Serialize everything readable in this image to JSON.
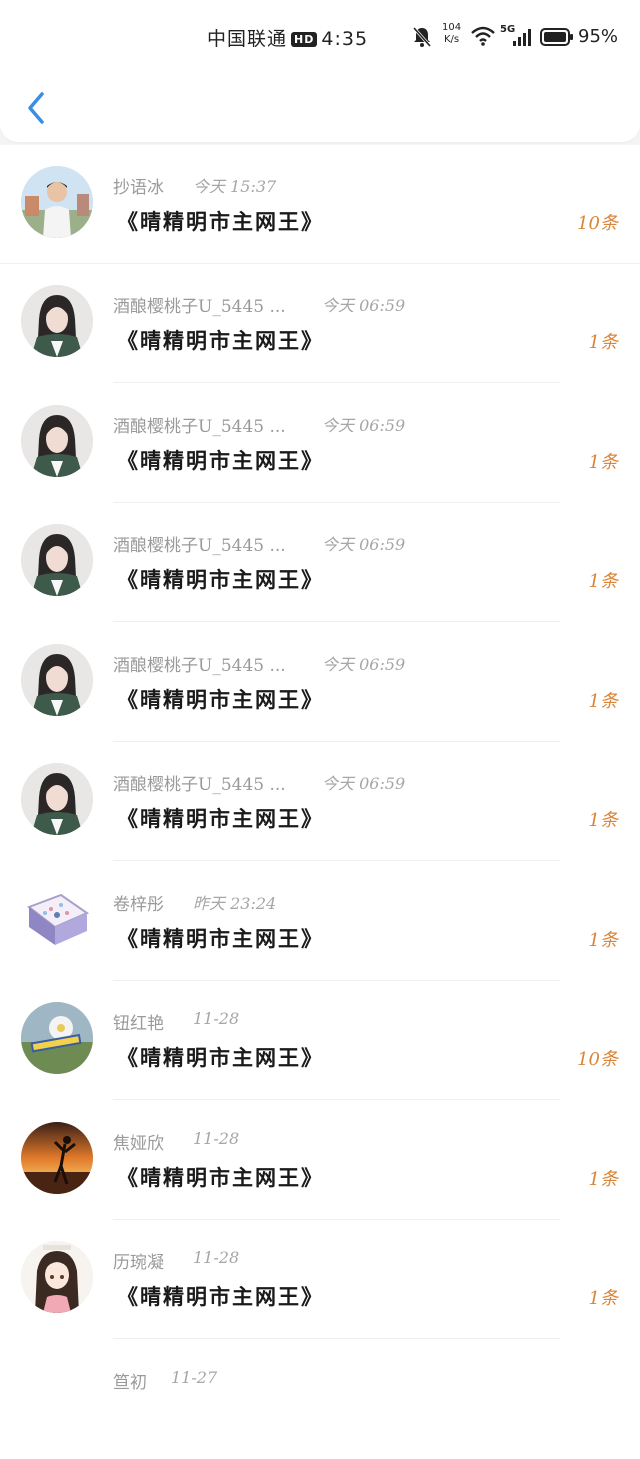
{
  "status_bar": {
    "carrier": "中国联通",
    "hd": "HD",
    "time": "4:35",
    "speed_top": "104",
    "speed_bottom": "K/s",
    "network": "5G",
    "battery": "95%"
  },
  "colors": {
    "accent_back": "#3a8ee6",
    "count": "#d9853a"
  },
  "rows": [
    {
      "name": "抄语冰",
      "date": "今天 15:37",
      "title": "《晴精明市主网王》",
      "count": "10条",
      "avatar": "boy-photo"
    },
    {
      "name": "酒酿樱桃子U_5445 ...",
      "date": "今天 06:59",
      "title": "《晴精明市主网王》",
      "count": "1条",
      "avatar": "girl-illustration"
    },
    {
      "name": "酒酿樱桃子U_5445 ...",
      "date": "今天 06:59",
      "title": "《晴精明市主网王》",
      "count": "1条",
      "avatar": "girl-illustration"
    },
    {
      "name": "酒酿樱桃子U_5445 ...",
      "date": "今天 06:59",
      "title": "《晴精明市主网王》",
      "count": "1条",
      "avatar": "girl-illustration"
    },
    {
      "name": "酒酿樱桃子U_5445 ...",
      "date": "今天 06:59",
      "title": "《晴精明市主网王》",
      "count": "1条",
      "avatar": "girl-illustration"
    },
    {
      "name": "酒酿樱桃子U_5445 ...",
      "date": "今天 06:59",
      "title": "《晴精明市主网王》",
      "count": "1条",
      "avatar": "girl-illustration"
    },
    {
      "name": "卷梓彤",
      "date": "昨天 23:24",
      "title": "《晴精明市主网王》",
      "count": "1条",
      "avatar": "gift-box"
    },
    {
      "name": "钮红艳",
      "date": "11-28",
      "title": "《晴精明市主网王》",
      "count": "10条",
      "avatar": "flower-photo"
    },
    {
      "name": "焦娅欣",
      "date": "11-28",
      "title": "《晴精明市主网王》",
      "count": "1条",
      "avatar": "sunset-silhouette"
    },
    {
      "name": "历琬凝",
      "date": "11-28",
      "title": "《晴精明市主网王》",
      "count": "1条",
      "avatar": "anime-girl"
    },
    {
      "name": "笪初",
      "date": "11-27",
      "title": "",
      "count": "",
      "avatar": "none"
    }
  ]
}
